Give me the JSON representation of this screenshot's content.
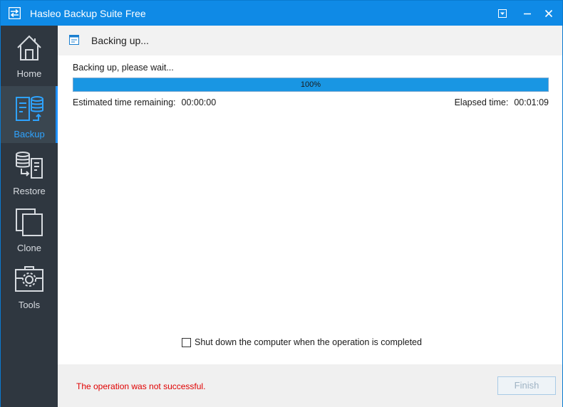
{
  "window": {
    "title": "Hasleo Backup Suite Free"
  },
  "sidebar": {
    "items": [
      {
        "label": "Home",
        "icon": "home-icon",
        "active": false
      },
      {
        "label": "Backup",
        "icon": "backup-icon",
        "active": true
      },
      {
        "label": "Restore",
        "icon": "restore-icon",
        "active": false
      },
      {
        "label": "Clone",
        "icon": "clone-icon",
        "active": false
      },
      {
        "label": "Tools",
        "icon": "tools-icon",
        "active": false
      }
    ]
  },
  "main": {
    "header_title": "Backing up...",
    "status_line": "Backing up, please wait...",
    "progress_percent": 100,
    "progress_label": "100%",
    "estimated_label": "Estimated time remaining:",
    "estimated_value": "00:00:00",
    "elapsed_label": "Elapsed time:",
    "elapsed_value": "00:01:09",
    "shutdown_label": "Shut down the computer when the operation is completed",
    "shutdown_checked": false
  },
  "footer": {
    "error_message": "The operation was not successful.",
    "finish_label": "Finish"
  },
  "colors": {
    "titlebar": "#0f8ae6",
    "sidebar": "#2f3740",
    "progress_fill": "#1996e3",
    "error": "#e00000",
    "active_nav": "#2ea3ff"
  }
}
